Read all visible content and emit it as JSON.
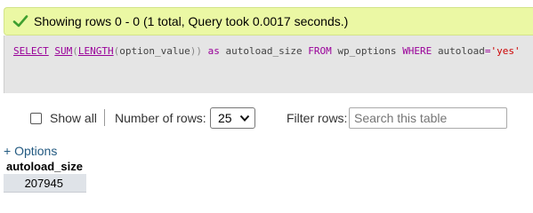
{
  "status": {
    "message": "Showing rows 0 - 0 (1 total, Query took 0.0017 seconds.)",
    "icon": "check-icon",
    "color": "#ebf8a4"
  },
  "sql": {
    "select": "SELECT",
    "fn_sum": "SUM",
    "fn_length": "LENGTH",
    "column": "option_value",
    "as": "as",
    "alias": "autoload_size",
    "from": "FROM",
    "table": "wp_options",
    "where": "WHERE",
    "where_col": "autoload",
    "where_val": "'yes'"
  },
  "controls": {
    "show_all_label": "Show all",
    "show_all_checked": false,
    "rows_label": "Number of rows:",
    "rows_value": "25",
    "filter_label": "Filter rows:",
    "filter_placeholder": "Search this table"
  },
  "options_link": "+ Options",
  "results": {
    "columns": [
      "autoload_size"
    ],
    "rows": [
      [
        "207945"
      ]
    ]
  }
}
